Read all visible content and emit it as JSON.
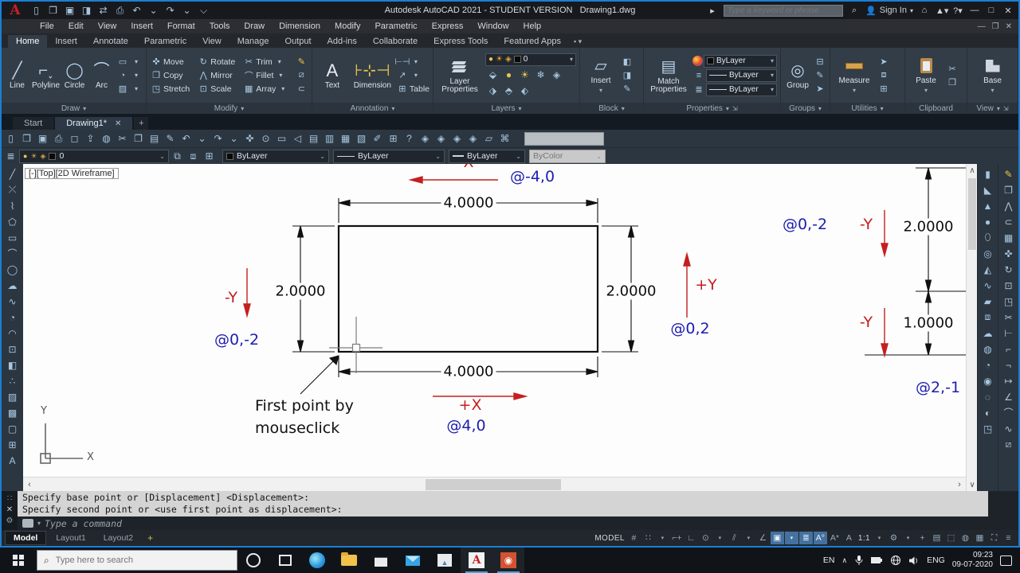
{
  "titlebar": {
    "title": "Autodesk AutoCAD 2021 - STUDENT VERSION",
    "doc": "Drawing1.dwg",
    "search_placeholder": "Type a keyword or phrase",
    "sign_in": "Sign In"
  },
  "menus": [
    "File",
    "Edit",
    "View",
    "Insert",
    "Format",
    "Tools",
    "Draw",
    "Dimension",
    "Modify",
    "Parametric",
    "Express",
    "Window",
    "Help"
  ],
  "ribbon_tabs": [
    "Home",
    "Insert",
    "Annotate",
    "Parametric",
    "View",
    "Manage",
    "Output",
    "Add-ins",
    "Collaborate",
    "Express Tools",
    "Featured Apps"
  ],
  "panels": {
    "draw": {
      "label": "Draw",
      "buttons": [
        "Line",
        "Polyline",
        "Circle",
        "Arc"
      ]
    },
    "modify": {
      "label": "Modify",
      "grid": [
        [
          "Move",
          "Rotate",
          "Trim"
        ],
        [
          "Copy",
          "Mirror",
          "Fillet"
        ],
        [
          "Stretch",
          "Scale",
          "Array"
        ]
      ]
    },
    "annotation": {
      "label": "Annotation",
      "text": "Text",
      "dimension": "Dimension",
      "table": "Table"
    },
    "layers": {
      "label": "Layers",
      "big": "Layer Properties",
      "layer_value": "0"
    },
    "block": {
      "label": "Block",
      "big": "Insert"
    },
    "properties": {
      "label": "Properties",
      "big": "Match Properties",
      "color": "ByLayer",
      "linetype": "ByLayer",
      "lineweight": "ByLayer"
    },
    "groups": {
      "label": "Groups",
      "big": "Group"
    },
    "utilities": {
      "label": "Utilities",
      "big": "Measure"
    },
    "clipboard": {
      "label": "Clipboard",
      "big": "Paste"
    },
    "view": {
      "label": "View",
      "big": "Base"
    }
  },
  "file_tabs": {
    "start": "Start",
    "drawing": "Drawing1*"
  },
  "toolbar2": {
    "layer": "0",
    "color": "ByLayer",
    "linetype": "ByLayer",
    "lineweight": "ByLayer",
    "plotstyle": "ByColor"
  },
  "viewport": {
    "label": "[-][Top][2D Wireframe]",
    "ucs_x": "X",
    "ucs_y": "Y"
  },
  "drawing": {
    "dim_top": "4.0000",
    "dim_bottom": "4.0000",
    "dim_left": "2.0000",
    "dim_right": "2.0000",
    "dim_far_top": "2.0000",
    "dim_far_bottom": "1.0000",
    "lbl_neg_x": "-X",
    "lbl_neg_y_left": "-Y",
    "lbl_pos_x": "+X",
    "lbl_pos_y": "+Y",
    "lbl_neg_y_rt": "-Y",
    "lbl_neg_y_rb": "-Y",
    "coord_top": "@-4,0",
    "coord_left": "@0,-2",
    "coord_bottom": "@4,0",
    "coord_mid": "@0,2",
    "coord_rt": "@0,-2",
    "coord_rb": "@2,-1",
    "note": "First point by\nmouseclick",
    "colors": {
      "red": "#c3201f",
      "blue": "#1d1db0",
      "line": "#111111"
    }
  },
  "command": {
    "line1": "Specify base point or [Displacement] <Displacement>:",
    "line2": "Specify second point or <use first point as displacement>:",
    "placeholder": "Type a command"
  },
  "layout_tabs": [
    "Model",
    "Layout1",
    "Layout2"
  ],
  "status": {
    "model": "MODEL",
    "scale": "1:1"
  },
  "taskbar": {
    "search_placeholder": "Type here to search",
    "lang": "EN",
    "lang2": "ENG",
    "time": "09:23",
    "date": "09-07-2020"
  },
  "lists": {
    "quick_access": [
      "new-file-icon",
      "open-file-icon",
      "save-icon",
      "save-as-icon",
      "transfer-icon",
      "plot-icon",
      "undo-icon",
      "undo-caret-icon",
      "redo-icon",
      "redo-caret-icon",
      "qat-customize-icon"
    ],
    "toolbar1": [
      "new-file-icon",
      "open-file-icon",
      "save-icon",
      "plot-icon",
      "plot-preview-icon",
      "publish-icon",
      "web-icon",
      "cut-icon",
      "copy-clip-icon",
      "paste-icon",
      "match-properties-icon",
      "undo-icon",
      "caret-icon",
      "redo-icon",
      "caret-icon",
      "pan-icon",
      "zoom-realtime-icon",
      "zoom-window-icon",
      "zoom-previous-icon",
      "properties-palette-icon",
      "designcenter-icon",
      "tool-palettes-icon",
      "sheetset-icon",
      "markup-icon",
      "quickcalc-icon",
      "help-icon",
      "view-cube-icon",
      "view-cube-icon",
      "view-cube-icon",
      "view-cube-icon",
      "named-views-icon",
      "camera-icon"
    ],
    "layer_tools": [
      "layer-previous-icon",
      "layer-bulb-icon",
      "layer-sun-icon",
      "layer-freeze-icon",
      "layer-lock-icon"
    ],
    "layer_tools2": [
      "make-current-icon",
      "layer-match-icon",
      "layer-prev2-icon"
    ],
    "left_strip": [
      "line-icon",
      "xline-icon",
      "polyline-icon",
      "polygon-icon",
      "rectangle-icon",
      "arc-icon",
      "circle-icon",
      "revcloud-icon",
      "spline-icon",
      "ellipse-icon",
      "ellipse-arc-icon",
      "insert-block-icon",
      "make-block-icon",
      "point-icon",
      "hatch-icon",
      "gradient-icon",
      "region-icon",
      "table-icon",
      "mtext-icon"
    ],
    "right_model": [
      "box-icon",
      "wedge-icon",
      "cone-icon",
      "sphere-icon",
      "cylinder-icon",
      "torus-icon",
      "pyramid-icon",
      "helix-icon",
      "planesurf-icon",
      "extrude-icon",
      "loft-icon",
      "revolve-icon",
      "sweep-icon",
      "union-icon",
      "subtract-icon",
      "intersect-icon",
      "sculpt-icon"
    ],
    "right_modify": [
      "erase-icon",
      "copy-icon",
      "mirror-icon",
      "offset-icon",
      "array-icon",
      "move-icon",
      "rotate-icon",
      "scale-icon",
      "stretch-icon",
      "trim-icon",
      "extend-icon",
      "break-point-icon",
      "break-icon",
      "join-icon",
      "chamfer-icon",
      "fillet-icon",
      "blend-icon",
      "explode-icon"
    ]
  }
}
